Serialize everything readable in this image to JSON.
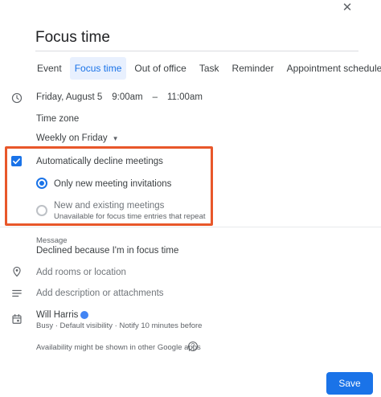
{
  "dialog": {
    "close_icon": "close-icon",
    "title": "Focus time"
  },
  "tabs": [
    {
      "label": "Event",
      "active": false
    },
    {
      "label": "Focus time",
      "active": true
    },
    {
      "label": "Out of office",
      "active": false
    },
    {
      "label": "Task",
      "active": false
    },
    {
      "label": "Reminder",
      "active": false
    },
    {
      "label": "Appointment schedule",
      "active": false
    }
  ],
  "when": {
    "date": "Friday, August 5",
    "start_time": "9:00am",
    "separator": "–",
    "end_time": "11:00am",
    "time_zone_label": "Time zone",
    "recurrence": "Weekly on Friday"
  },
  "decline": {
    "checkbox_label": "Automatically decline meetings",
    "checked": true,
    "options": [
      {
        "label": "Only new meeting invitations",
        "selected": true,
        "note": ""
      },
      {
        "label": "New and existing meetings",
        "selected": false,
        "note": "Unavailable for focus time entries that repeat"
      }
    ]
  },
  "message": {
    "label": "Message",
    "value": "Declined because I'm in focus time"
  },
  "location": {
    "placeholder": "Add rooms or location"
  },
  "description": {
    "placeholder": "Add description or attachments"
  },
  "owner": {
    "name": "Will Harris",
    "calendar_color": "#4285f4",
    "details": "Busy · Default visibility · Notify 10 minutes before"
  },
  "availability_note": "Availability might be shown in other Google apps",
  "footer": {
    "save_label": "Save"
  },
  "colors": {
    "accent": "#1a73e8",
    "highlight": "#e8572a"
  }
}
